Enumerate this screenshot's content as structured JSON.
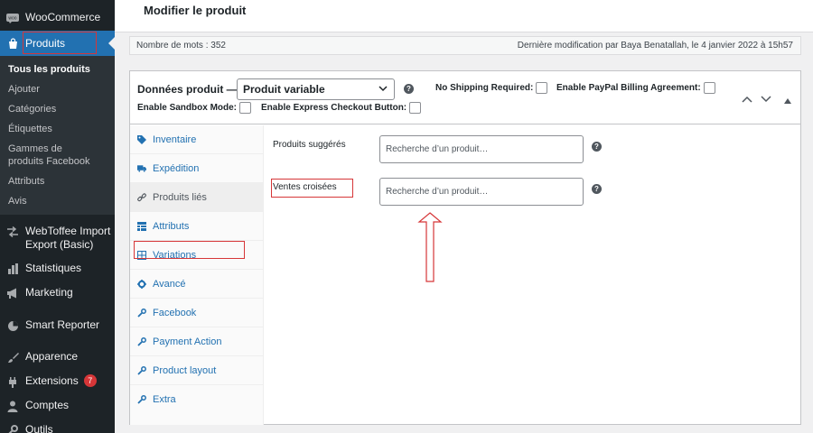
{
  "sidebar": {
    "woocommerce": "WooCommerce",
    "produits": "Produits",
    "submenu": [
      "Tous les produits",
      "Ajouter",
      "Catégories",
      "Étiquettes",
      "Gammes de produits Facebook",
      "Attributs",
      "Avis"
    ],
    "items": [
      {
        "label": "WebToffee Import Export (Basic)",
        "icon": "import-export-icon"
      },
      {
        "label": "Statistiques",
        "icon": "chart-bar-icon"
      },
      {
        "label": "Marketing",
        "icon": "megaphone-icon"
      },
      {
        "label": "Smart Reporter",
        "icon": "chart-pie-icon"
      },
      {
        "label": "Apparence",
        "icon": "paintbrush-icon"
      },
      {
        "label": "Extensions",
        "icon": "plugin-icon",
        "badge": "7"
      },
      {
        "label": "Comptes",
        "icon": "users-icon"
      },
      {
        "label": "Outils",
        "icon": "wrench-icon"
      }
    ]
  },
  "header": {
    "title": "Modifier le produit"
  },
  "infobar": {
    "word_count": "Nombre de mots : 352",
    "last_modified": "Dernière modification par Baya Benatallah, le 4 janvier 2022 à 15h57"
  },
  "product_data": {
    "title": "Données produit —",
    "type_selected": "Produit variable",
    "options": {
      "no_shipping": "No Shipping Required:",
      "paypal_billing": "Enable PayPal Billing Agreement:",
      "sandbox": "Enable Sandbox Mode:",
      "express_checkout": "Enable Express Checkout Button:"
    },
    "tabs": [
      "Inventaire",
      "Expédition",
      "Produits liés",
      "Attributs",
      "Variations",
      "Avancé",
      "Facebook",
      "Payment Action",
      "Product layout",
      "Extra"
    ],
    "fields": {
      "upsells_label": "Produits suggérés",
      "upsells_placeholder": "Recherche d’un produit…",
      "crosssells_label": "Ventes croisées",
      "crosssells_placeholder": "Recherche d’un produit…"
    }
  },
  "colors": {
    "sidebar_bg": "#1d2327",
    "accent": "#2271b1",
    "annotation": "#d63638"
  }
}
